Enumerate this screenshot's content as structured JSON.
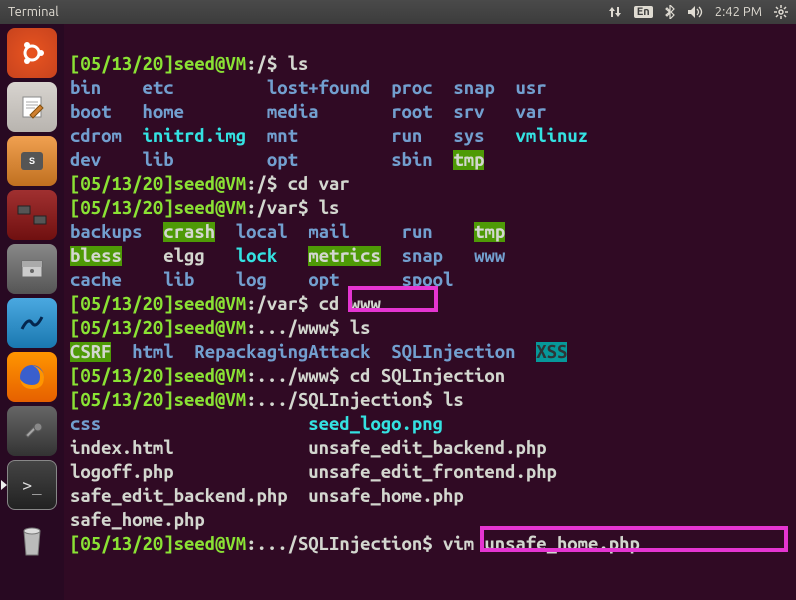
{
  "topbar": {
    "title": "Terminal",
    "lang": "En",
    "time": "2:42 PM"
  },
  "launcher": {
    "items": [
      "ubuntu",
      "text-editor",
      "sublime",
      "remmina",
      "file-manager",
      "wireshark",
      "firefox",
      "settings",
      "terminal",
      "trash"
    ]
  },
  "term": {
    "p_root": "[05/13/20]",
    "user_host": "seed@VM",
    "loc_root": ":/$",
    "loc_var": ":/var$",
    "loc_www": ":.../www$",
    "loc_sql": ":.../SQLInjection$",
    "cmd_ls": " ls",
    "cmd_cdvar": " cd var",
    "cmd_cdwww": " cd www",
    "cmd_cdsql": " cd SQLInjection",
    "cmd_vim": " vim unsafe_home.php",
    "root_ls": {
      "r1": [
        "bin    ",
        "etc         ",
        "lost+found  ",
        "proc  ",
        "snap  ",
        "usr"
      ],
      "r2": [
        "boot   ",
        "home        ",
        "media       ",
        "root  ",
        "srv   ",
        "var"
      ],
      "r3a": "cdrom  ",
      "r3b": "initrd.img",
      "r3c": "  ",
      "r3d": "mnt         ",
      "r3e": "run   ",
      "r3f": "sys   ",
      "r3g": "vmlinuz",
      "r4a": "dev    ",
      "r4b": "lib         ",
      "r4c": "opt         ",
      "r4d": "sbin  ",
      "r4e": "tmp"
    },
    "var_ls": {
      "r1a": "backups  ",
      "r1b": "crash",
      "r1c": "  ",
      "r1d": "local  ",
      "r1e": "mail     ",
      "r1f": "run    ",
      "r1g": "tmp",
      "r2a": "bless",
      "r2b": "    ",
      "r2c": "elgg   ",
      "r2d": "lock   ",
      "r2e": "metrics",
      "r2f": "  ",
      "r2g": "snap   ",
      "r2h": "www",
      "r3a": "cache    ",
      "r3b": "lib    ",
      "r3c": "log    ",
      "r3d": "opt      ",
      "r3e": "spool"
    },
    "www_ls": {
      "a": "CSRF",
      "b": "  ",
      "c": "html  ",
      "d": "RepackagingAttack  ",
      "e": "SQLInjection  ",
      "f": "XSS"
    },
    "sql_ls": {
      "r1a": "css",
      "r1b": "                    ",
      "r1c": "seed_logo.png",
      "r2": "index.html             unsafe_edit_backend.php",
      "r3": "logoff.php             unsafe_edit_frontend.php",
      "r4": "safe_edit_backend.php  unsafe_home.php",
      "r5": "safe_home.php"
    }
  }
}
